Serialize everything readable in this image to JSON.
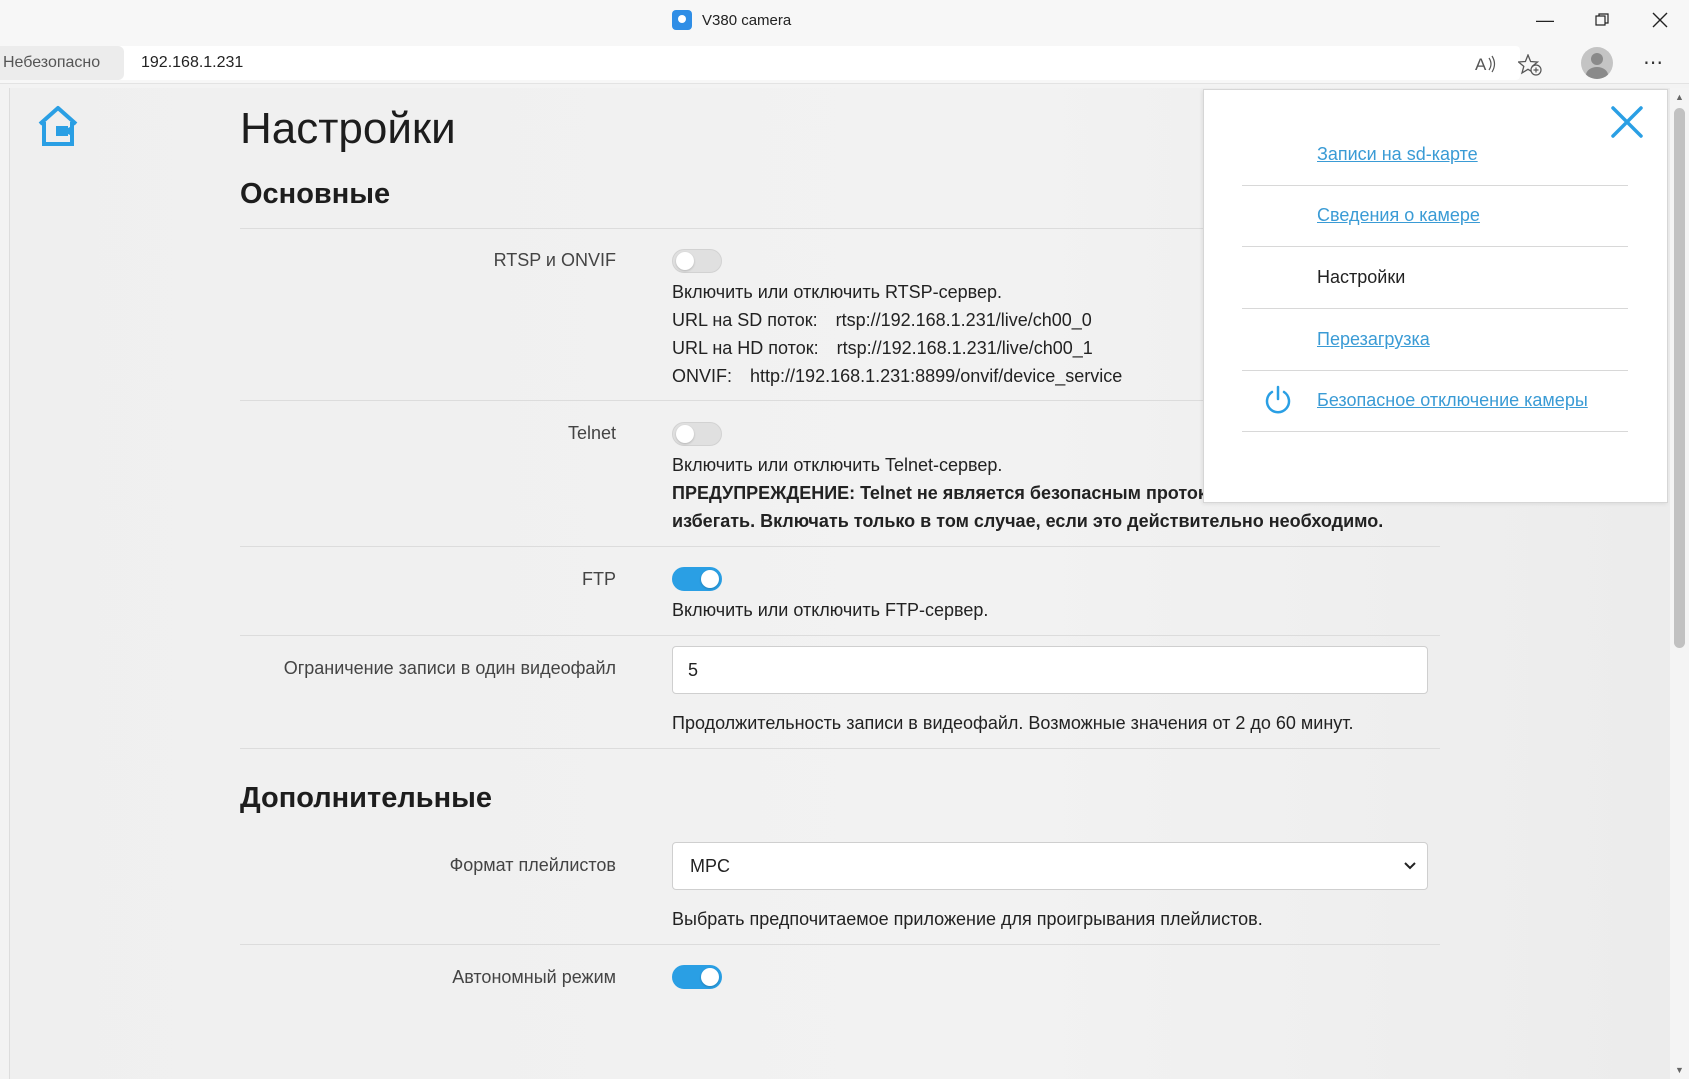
{
  "window": {
    "title": "V380 camera",
    "minimize_icon": "minimize-icon",
    "maximize_icon": "restore-icon",
    "close_icon": "close-icon"
  },
  "addressbar": {
    "security_label": "Небезопасно",
    "url": "192.168.1.231"
  },
  "page": {
    "title": "Настройки",
    "sections": {
      "basic": "Основные",
      "additional": "Дополнительные"
    },
    "rtsp": {
      "label": "RTSP и ONVIF",
      "enabled": false,
      "description": "Включить или отключить RTSP-сервер.",
      "sd_label": "URL на SD поток:",
      "sd_url": "rtsp://192.168.1.231/live/ch00_0",
      "hd_label": "URL на HD поток:",
      "hd_url": "rtsp://192.168.1.231/live/ch00_1",
      "onvif_label": "ONVIF:",
      "onvif_url": "http://192.168.1.231:8899/onvif/device_service"
    },
    "telnet": {
      "label": "Telnet",
      "enabled": false,
      "description": "Включить или отключить Telnet-сервер.",
      "warning_line1": "ПРЕДУПРЕЖДЕНИЕ: Telnet не является безопасным протоколом, и его следует",
      "warning_line2": "избегать. Включать только в том случае, если это действительно необходимо."
    },
    "ftp": {
      "label": "FTP",
      "enabled": true,
      "description": "Включить или отключить FTP-сервер."
    },
    "record_limit": {
      "label": "Ограничение записи в один видеофайл",
      "value": "5",
      "description": "Продолжительность записи в видеофайл. Возможные значения от 2 до 60 минут."
    },
    "playlist_format": {
      "label": "Формат плейлистов",
      "selected": "MPC",
      "description": "Выбрать предпочитаемое приложение для проигрывания плейлистов."
    },
    "autonomous": {
      "label": "Автономный режим",
      "enabled": true
    }
  },
  "sidemenu": {
    "items": [
      {
        "label": "Записи на sd-карте",
        "link": true
      },
      {
        "label": "Сведения о камере",
        "link": true
      },
      {
        "label": "Настройки",
        "link": false
      },
      {
        "label": "Перезагрузка",
        "link": true
      },
      {
        "label": "Безопасное отключение камеры",
        "link": true,
        "icon": "power-icon"
      }
    ]
  },
  "colors": {
    "accent": "#2a9fe4",
    "link": "#3a9bd5"
  }
}
